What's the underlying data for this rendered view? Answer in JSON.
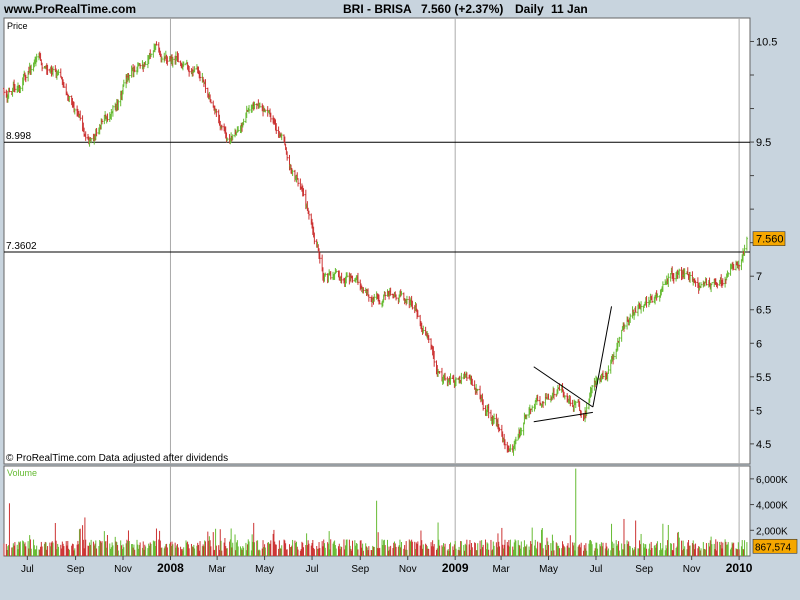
{
  "header": {
    "site": "www.ProRealTime.com",
    "symbol": "BRI - BRISA",
    "quote": "7.560 (+2.37%)",
    "period": "Daily",
    "date": "11 Jan"
  },
  "labels": {
    "price_panel": "Price",
    "volume_panel": "Volume",
    "footer": "© ProRealTime.com  Data adjusted after dividends"
  },
  "colors": {
    "background": "#c8d4de",
    "panel": "#ffffff",
    "up": "#66bb33",
    "down": "#cc3333",
    "last_price_box": "#f5a700",
    "volume_green": "#66bb33"
  },
  "chart_data": [
    {
      "type": "line",
      "title": "BRI - BRISA",
      "ylabel": "Price",
      "ylim": [
        4.2,
        10.85
      ],
      "yticks": [
        4.5,
        5,
        5.5,
        6,
        6.5,
        7,
        7.5,
        8,
        8.5,
        9,
        9.5,
        10,
        10.5
      ],
      "ytick_labels": [
        "4.5",
        "5",
        "5.5",
        "6",
        "6.5",
        "7",
        "",
        "",
        "",
        "9.5",
        "",
        "",
        "10.5"
      ],
      "x_tick_labels": [
        "Jul",
        "Sep",
        "Nov",
        "2008",
        "Mar",
        "May",
        "Jul",
        "Sep",
        "Nov",
        "2009",
        "Mar",
        "May",
        "Jul",
        "Sep",
        "Nov",
        "2010"
      ],
      "x_tick_bold": [
        false,
        false,
        false,
        true,
        false,
        false,
        false,
        false,
        false,
        true,
        false,
        false,
        false,
        false,
        false,
        true
      ],
      "grid": "vertical lines at year boundaries",
      "series": [
        {
          "x": [
            "2007-06",
            "2007-07",
            "2007-08",
            "2007-09",
            "2007-10",
            "2007-11",
            "2007-12",
            "2008-01",
            "2008-02",
            "2008-03",
            "2008-04",
            "2008-05",
            "2008-06",
            "2008-07",
            "2008-08",
            "2008-09",
            "2008-10",
            "2008-11",
            "2008-12",
            "2009-01",
            "2009-02",
            "2009-03",
            "2009-04",
            "2009-05",
            "2009-06",
            "2009-07",
            "2009-08",
            "2009-09",
            "2009-10",
            "2009-11",
            "2009-12",
            "2010-01"
          ],
          "values": [
            9.8,
            10.3,
            10.0,
            9.1,
            9.4,
            10.0,
            10.3,
            10.1,
            9.8,
            9.1,
            9.6,
            9.2,
            8.4,
            7.0,
            7.0,
            6.6,
            6.8,
            6.4,
            5.4,
            5.5,
            4.9,
            4.5,
            5.2,
            5.3,
            5.0,
            5.6,
            6.4,
            6.7,
            7.1,
            6.8,
            6.9,
            7.56
          ]
        }
      ],
      "annotations": {
        "hlines": [
          {
            "value": 8.998,
            "label": "8.998"
          },
          {
            "value": 7.3602,
            "label": "7.3602"
          }
        ],
        "last_price": "7.560",
        "trendlines": [
          {
            "from": [
              "2009-04-12",
              5.65
            ],
            "to": [
              "2009-06-27",
              5.05
            ]
          },
          {
            "from": [
              "2009-04-12",
              4.83
            ],
            "to": [
              "2009-06-27",
              4.97
            ]
          },
          {
            "from": [
              "2009-06-27",
              5.05
            ],
            "to": [
              "2009-07-21",
              6.55
            ]
          }
        ]
      }
    },
    {
      "type": "bar",
      "title": "Volume",
      "ylim": [
        0,
        7000
      ],
      "yticks": [
        2000,
        4000,
        6000
      ],
      "ytick_labels": [
        "2,000K",
        "4,000K",
        "6,000K"
      ],
      "last_value": "867,574",
      "spikes": [
        {
          "x": "2007-06-08",
          "value": 4100
        },
        {
          "x": "2008-09-22",
          "value": 4300
        },
        {
          "x": "2009-06-05",
          "value": 6800
        }
      ]
    }
  ]
}
